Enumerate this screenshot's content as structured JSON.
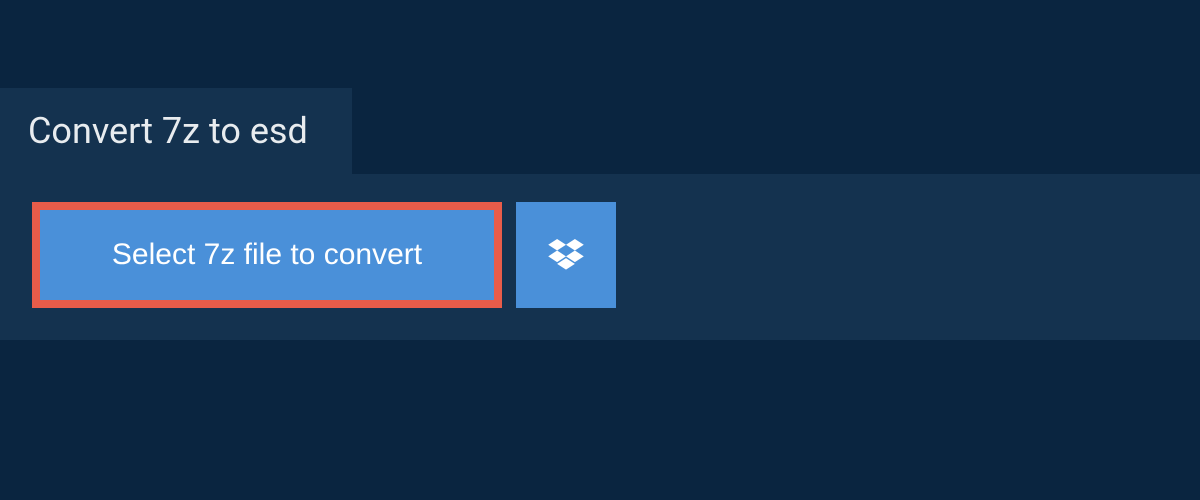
{
  "tab": {
    "label": "Convert 7z to esd"
  },
  "actions": {
    "select_file_label": "Select 7z file to convert"
  },
  "colors": {
    "background": "#0a2540",
    "panel": "#14324f",
    "button": "#4a90d9",
    "highlight_border": "#e85c4a",
    "text_light": "#e8ecef",
    "text_white": "#ffffff"
  }
}
